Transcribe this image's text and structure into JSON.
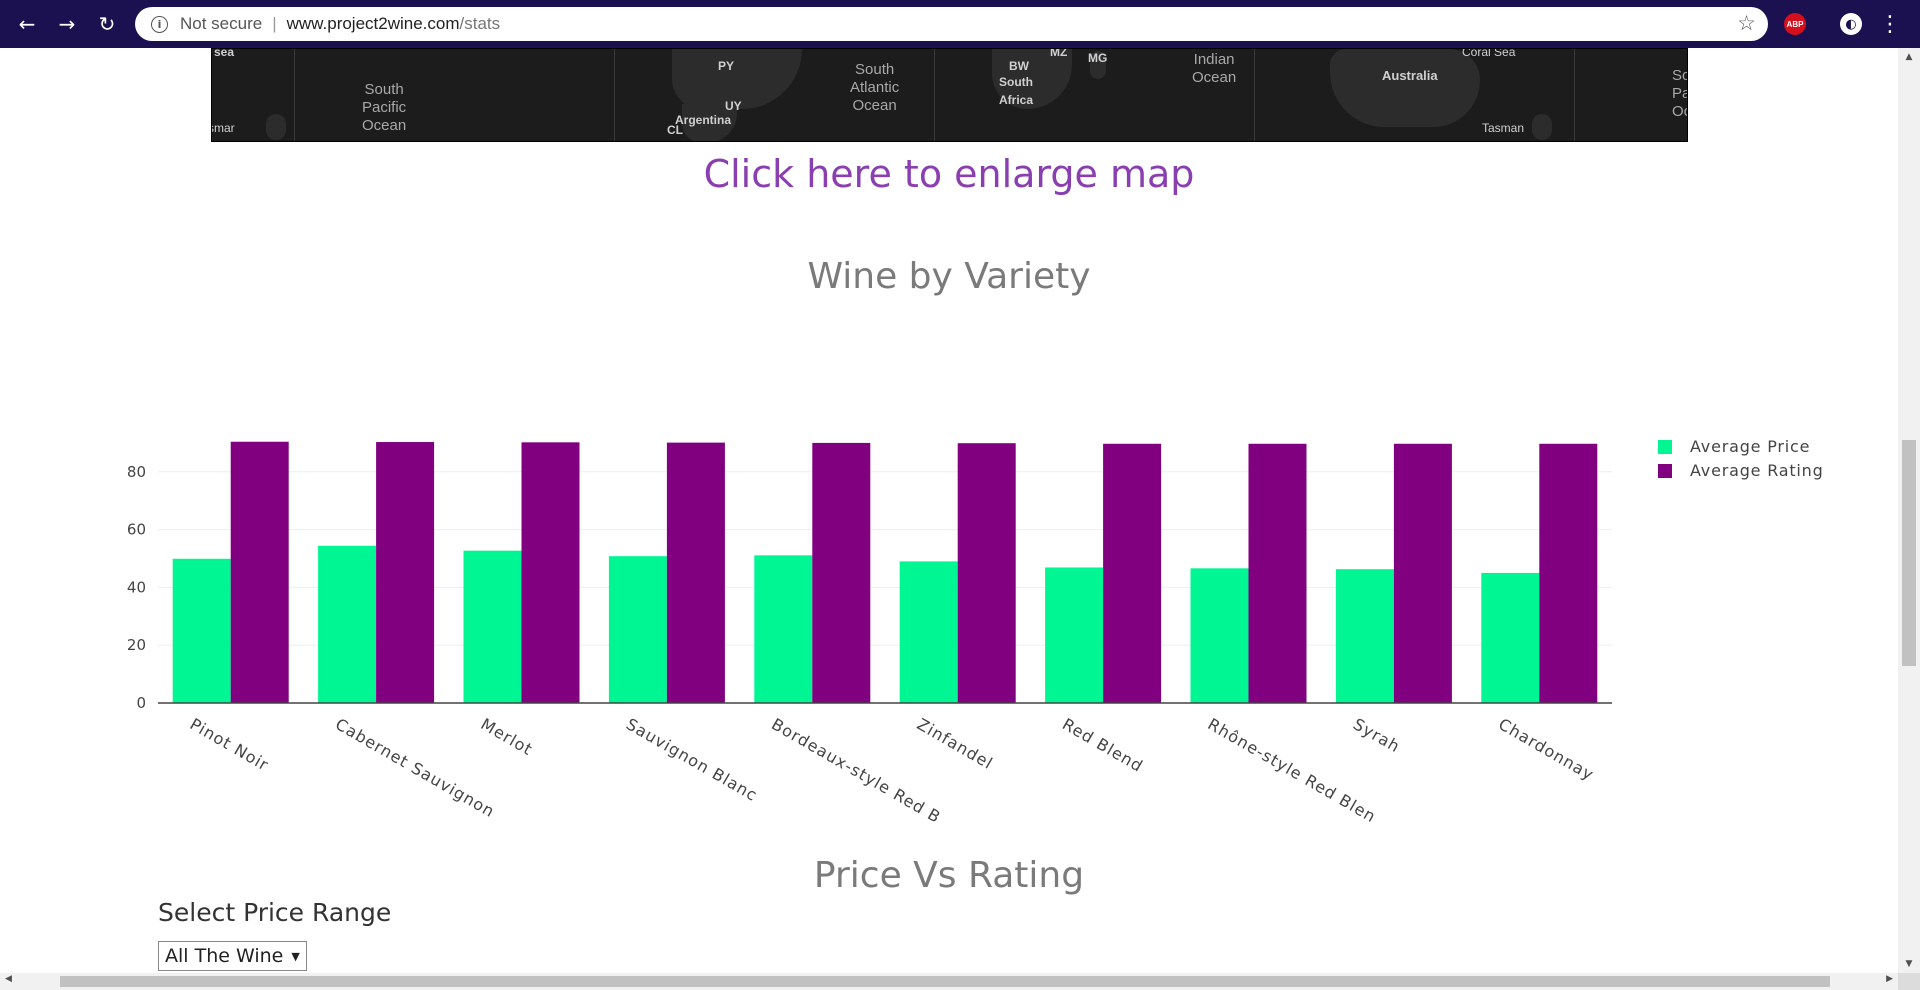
{
  "browser": {
    "security_label": "Not secure",
    "url_host": "www.project2wine.com",
    "url_path": "/stats",
    "extension_abp_label": "ABP"
  },
  "map": {
    "labels": [
      "sea",
      "South\nPacific\nOcean",
      "PY",
      "UY",
      "Argentina",
      "CL",
      "South\nAtlantic\nOcean",
      "BW",
      "South\nAfrica",
      "MZ",
      "MG",
      "Indian\nOcean",
      "Coral Sea",
      "Australia",
      "Tasman",
      "smar",
      "So\nPa\nOc"
    ]
  },
  "page": {
    "enlarge_map_link": "Click here to enlarge map",
    "chart_title": "Wine by Variety",
    "second_title": "Price Vs Rating",
    "price_range_label": "Select Price Range",
    "price_range_selected": "All The Wine"
  },
  "colors": {
    "price": "#00f593",
    "rating": "#800080",
    "link": "#8a3fb0"
  },
  "chart_data": {
    "type": "bar",
    "title": "Wine by Variety",
    "xlabel": "",
    "ylabel": "",
    "categories": [
      "Pinot Noir",
      "Cabernet Sauvignon",
      "Merlot",
      "Sauvignon Blanc",
      "Bordeaux-style Red B",
      "Zinfandel",
      "Red Blend",
      "Rhône-style Red Blen",
      "Syrah",
      "Chardonnay"
    ],
    "series": [
      {
        "name": "Average Price",
        "color": "#00f593",
        "values": [
          49.9,
          54.4,
          52.7,
          50.8,
          51.1,
          49.0,
          46.9,
          46.6,
          46.3,
          45.0
        ]
      },
      {
        "name": "Average Rating",
        "color": "#800080",
        "values": [
          90.4,
          90.3,
          90.2,
          90.1,
          90.0,
          89.9,
          89.7,
          89.7,
          89.7,
          89.7
        ]
      }
    ],
    "ylim": [
      0,
      100
    ],
    "yticks": [
      "0",
      "20",
      "40",
      "60",
      "80"
    ],
    "grid": true,
    "legend_position": "top-right"
  }
}
